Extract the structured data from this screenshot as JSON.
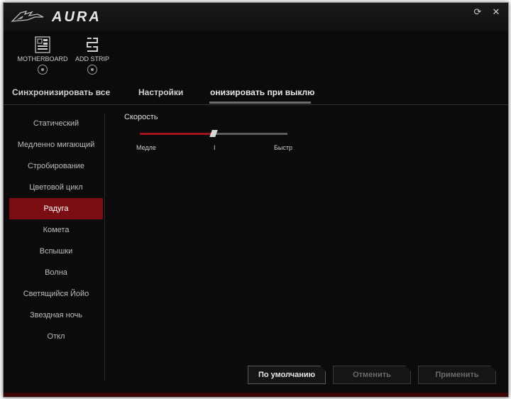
{
  "app": {
    "title": "AURA"
  },
  "window_controls": {
    "refresh_icon": "refresh-icon",
    "close_icon": "close-icon"
  },
  "devices": [
    {
      "label": "MOTHERBOARD",
      "icon": "motherboard-icon"
    },
    {
      "label": "ADD STRIP",
      "icon": "led-strip-icon"
    }
  ],
  "tabs": [
    {
      "label": "Синхронизировать все"
    },
    {
      "label": "Настройки"
    },
    {
      "label": "онизировать при выклю",
      "active": true
    }
  ],
  "sidebar": {
    "items": [
      {
        "label": "Статический"
      },
      {
        "label": "Медленно мигающий"
      },
      {
        "label": "Стробирование"
      },
      {
        "label": "Цветовой цикл"
      },
      {
        "label": "Радуга",
        "active": true
      },
      {
        "label": "Комета"
      },
      {
        "label": "Вспышки"
      },
      {
        "label": "Волна"
      },
      {
        "label": "Светящийся Йойо"
      },
      {
        "label": "Звездная ночь"
      },
      {
        "label": "Откл"
      }
    ]
  },
  "speed": {
    "label": "Скорость",
    "min_label": "Медле",
    "mid_label": "I",
    "max_label": "Быстр",
    "value_fraction": 0.5
  },
  "buttons": {
    "default": "По умолчанию",
    "cancel": "Отменить",
    "apply": "Применить"
  },
  "colors": {
    "accent": "#a0141b",
    "background": "#0b0b0b"
  }
}
